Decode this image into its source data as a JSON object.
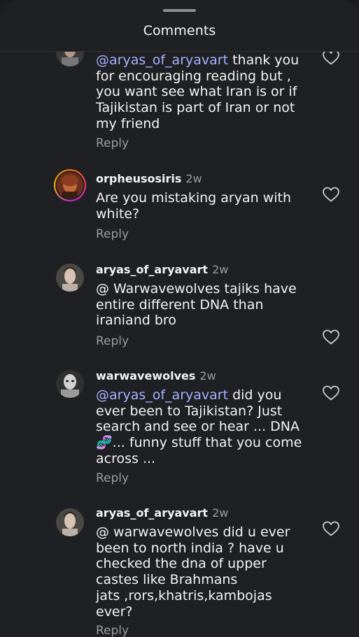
{
  "header": {
    "title": "Comments"
  },
  "comments": [
    {
      "body_mention": "@aryas_of_aryavart",
      "body_text": " thank you\nfor encouraging reading but ,\nyou want see what Iran is or if\nTajikistan is part of Iran or not\nmy friend",
      "reply_label": "Reply"
    },
    {
      "username": "orpheusosiris",
      "time": "2w",
      "body_text": "Are you mistaking aryan with\nwhite?",
      "reply_label": "Reply"
    },
    {
      "username": "aryas_of_aryavart",
      "time": "2w",
      "body_prefix_icon": "threads-icon",
      "body_text": " Warwavewolves tajiks have\nentire different DNA than\niraniand bro",
      "reply_label": "Reply"
    },
    {
      "username": "warwavewolves",
      "time": "2w",
      "body_mention": "@aryas_of_aryavart",
      "body_text": " did you\never been to Tajikistan? Just\nsearch and see or hear ... DNA\n🧬... funny stuff that you come\nacross ...",
      "reply_label": "Reply"
    },
    {
      "username": "aryas_of_aryavart",
      "time": "2w",
      "body_prefix_icon": "threads-icon",
      "body_text": " warwavewolves did u ever\nbeen to north india ? have u\nchecked the dna of upper\ncastes like Brahmans\njats ,rors,khatris,kambojas\never?",
      "reply_label": "Reply"
    }
  ],
  "icons": {
    "like": "heart-outline-icon",
    "threads": "threads-icon"
  },
  "colors": {
    "mention": "#a7b2ff",
    "background": "#1e2023",
    "muted": "#9a9ca1"
  }
}
